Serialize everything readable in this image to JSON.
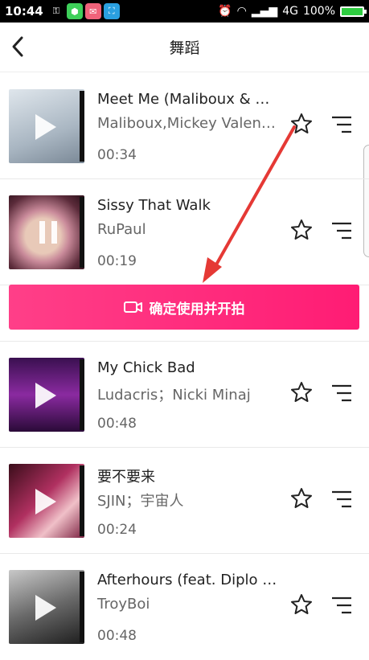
{
  "status_bar": {
    "time": "10:44",
    "network": "4G",
    "battery": "100%"
  },
  "header": {
    "title": "舞蹈"
  },
  "songs": [
    {
      "title": "Meet Me (Maliboux & U...",
      "artist": "Maliboux,Mickey Valen,...",
      "duration": "00:34",
      "state": "play"
    },
    {
      "title": "Sissy That Walk",
      "artist": "RuPaul",
      "duration": "00:19",
      "state": "pause"
    },
    {
      "title": "My Chick Bad",
      "artist": "Ludacris；Nicki Minaj",
      "duration": "00:48",
      "state": "play"
    },
    {
      "title": "要不要来",
      "artist": "SJIN；宇宙人",
      "duration": "00:24",
      "state": "play"
    },
    {
      "title": "Afterhours (feat. Diplo A...",
      "artist": "TroyBoi",
      "duration": "00:48",
      "state": "play"
    }
  ],
  "confirm_button": {
    "label": "确定使用并开拍"
  },
  "colors": {
    "accent": "#ff2a7c",
    "star_stroke": "#222222",
    "arrow": "#e53935"
  }
}
